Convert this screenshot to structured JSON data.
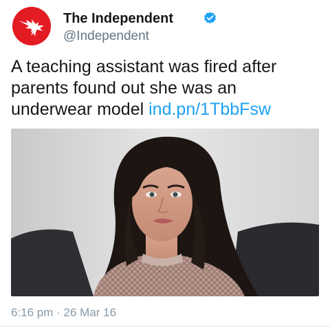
{
  "author": {
    "name": "The Independent",
    "handle": "@Independent",
    "verified": true,
    "avatar_icon": "eagle-logo-icon",
    "avatar_color": "#e31b23"
  },
  "tweet": {
    "text": "A teaching assistant was fired after parents found out she was an underwear model",
    "link": "ind.pn/1TbbFsw",
    "timestamp": "6:16 pm · 26 Mar 16"
  },
  "media": {
    "description_icon": "photo-of-woman-image"
  },
  "colors": {
    "link": "#1da1f2",
    "verified": "#1da1f2",
    "secondary_text": "#657786"
  }
}
